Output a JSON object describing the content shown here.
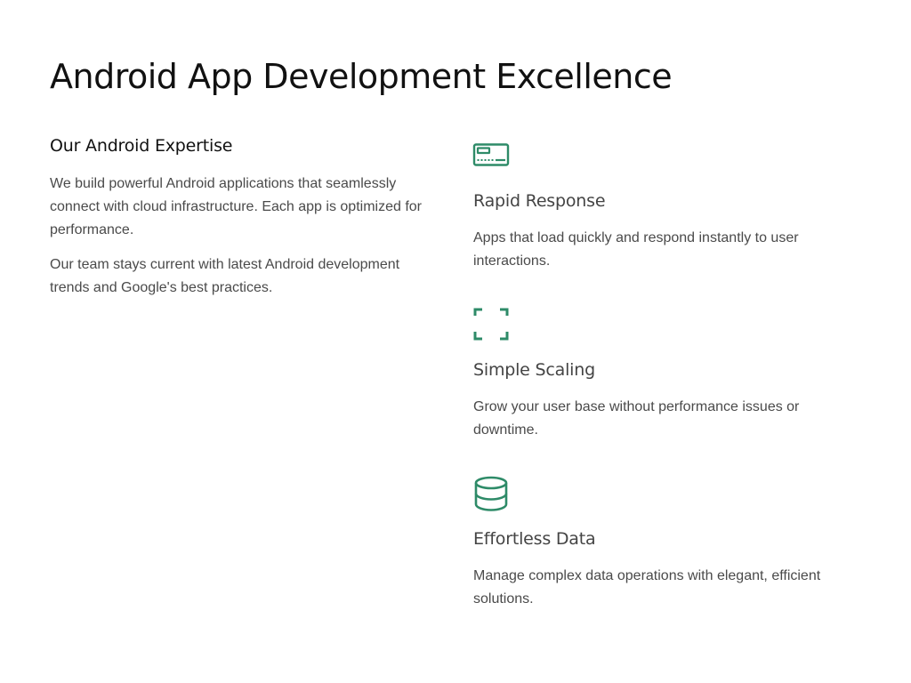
{
  "page": {
    "title": "Android App Development Excellence"
  },
  "expertise": {
    "heading": "Our Android Expertise",
    "paragraphs": [
      "We build powerful Android applications that seamlessly connect with cloud infrastructure. Each app is optimized for performance.",
      "Our team stays current with latest Android development trends and Google's best practices."
    ]
  },
  "features": [
    {
      "icon": "speed-meter-icon",
      "title": "Rapid Response",
      "description": "Apps that load quickly and respond instantly to user interactions."
    },
    {
      "icon": "expand-icon",
      "title": "Simple Scaling",
      "description": "Grow your user base without performance issues or downtime."
    },
    {
      "icon": "database-icon",
      "title": "Effortless Data",
      "description": "Manage complex data operations with elegant, efficient solutions."
    }
  ],
  "colors": {
    "accent": "#2e8b68",
    "heading": "#111111",
    "body_text": "#4a4a4a"
  }
}
